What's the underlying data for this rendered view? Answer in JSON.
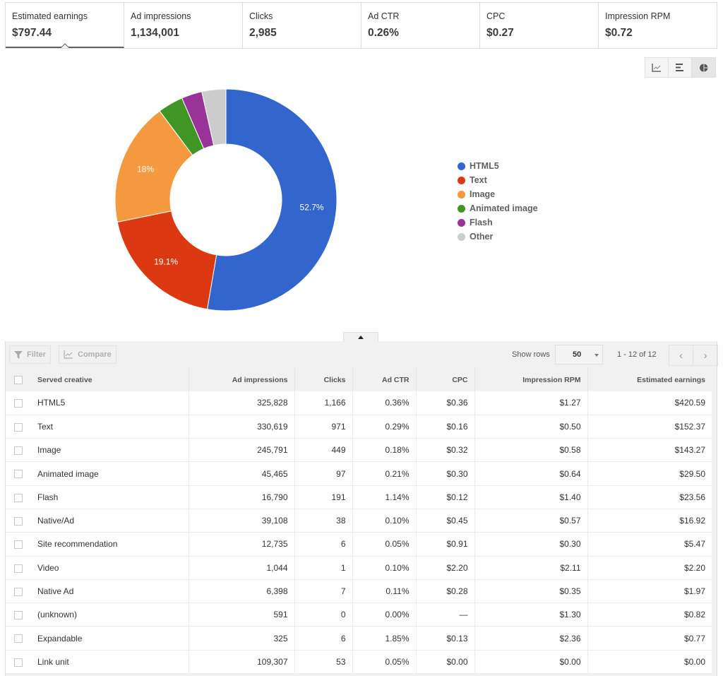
{
  "scorecards": [
    {
      "label": "Estimated earnings",
      "value": "$797.44",
      "active": true
    },
    {
      "label": "Ad impressions",
      "value": "1,134,001"
    },
    {
      "label": "Clicks",
      "value": "2,985"
    },
    {
      "label": "Ad CTR",
      "value": "0.26%"
    },
    {
      "label": "CPC",
      "value": "$0.27"
    },
    {
      "label": "Impression RPM",
      "value": "$0.72"
    }
  ],
  "chart_toggle": {
    "options": [
      "line-chart-icon",
      "bar-chart-icon",
      "pie-chart-icon"
    ],
    "selected": "pie-chart-icon"
  },
  "chart_data": {
    "type": "pie",
    "donut": true,
    "metric": "Estimated earnings",
    "labels": [
      "HTML5",
      "Text",
      "Image",
      "Animated image",
      "Flash",
      "Other"
    ],
    "values": [
      52.7,
      19.1,
      18.0,
      3.7,
      3.0,
      3.5
    ],
    "data_labels": [
      "52.7%",
      "19.1%",
      "18%",
      "",
      "",
      ""
    ],
    "colors": [
      "#3366cc",
      "#dc3912",
      "#f4993f",
      "#3f9624",
      "#993399",
      "#cccccc"
    ],
    "legend_position": "right"
  },
  "toolbar": {
    "filter_label": "Filter",
    "compare_label": "Compare",
    "show_rows_label": "Show rows",
    "rows_value": "50",
    "range_text": "1 - 12 of 12",
    "prev": "‹",
    "next": "›"
  },
  "table": {
    "headers": [
      "Served creative",
      "Ad impressions",
      "Clicks",
      "Ad CTR",
      "CPC",
      "Impression RPM",
      "Estimated earnings"
    ],
    "rows": [
      [
        "HTML5",
        "325,828",
        "1,166",
        "0.36%",
        "$0.36",
        "$1.27",
        "$420.59"
      ],
      [
        "Text",
        "330,619",
        "971",
        "0.29%",
        "$0.16",
        "$0.50",
        "$152.37"
      ],
      [
        "Image",
        "245,791",
        "449",
        "0.18%",
        "$0.32",
        "$0.58",
        "$143.27"
      ],
      [
        "Animated image",
        "45,465",
        "97",
        "0.21%",
        "$0.30",
        "$0.64",
        "$29.50"
      ],
      [
        "Flash",
        "16,790",
        "191",
        "1.14%",
        "$0.12",
        "$1.40",
        "$23.56"
      ],
      [
        "Native/Ad",
        "39,108",
        "38",
        "0.10%",
        "$0.45",
        "$0.57",
        "$16.92"
      ],
      [
        "Site recommendation",
        "12,735",
        "6",
        "0.05%",
        "$0.91",
        "$0.30",
        "$5.47"
      ],
      [
        "Video",
        "1,044",
        "1",
        "0.10%",
        "$2.20",
        "$2.11",
        "$2.20"
      ],
      [
        "Native Ad",
        "6,398",
        "7",
        "0.11%",
        "$0.28",
        "$0.35",
        "$1.97"
      ],
      [
        "(unknown)",
        "591",
        "0",
        "0.00%",
        "—",
        "$1.30",
        "$0.82"
      ],
      [
        "Expandable",
        "325",
        "6",
        "1.85%",
        "$0.13",
        "$2.36",
        "$0.77"
      ],
      [
        "Link unit",
        "109,307",
        "53",
        "0.05%",
        "$0.00",
        "$0.00",
        "$0.00"
      ]
    ]
  }
}
